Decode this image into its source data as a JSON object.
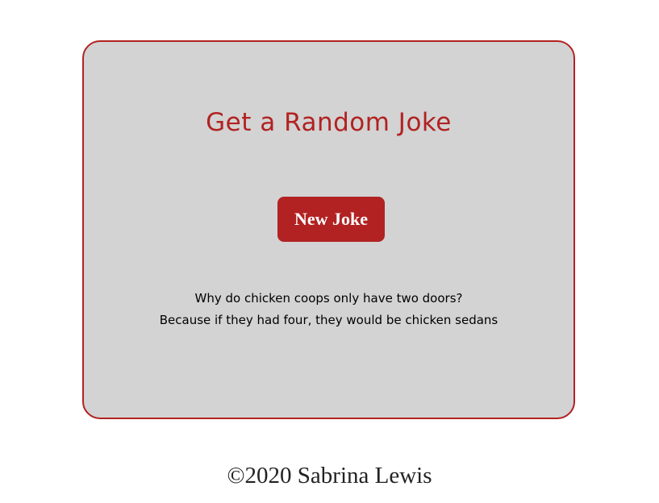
{
  "card": {
    "title": "Get a Random Joke",
    "button_label": "New Joke",
    "joke": {
      "setup": "Why do chicken coops only have two doors?",
      "punchline": "Because if they had four, they would be chicken sedans"
    }
  },
  "footer": {
    "text": "©2020 Sabrina Lewis"
  },
  "colors": {
    "accent": "#b22222",
    "card_background": "#d3d3d3",
    "page_background": "#ffffff"
  }
}
